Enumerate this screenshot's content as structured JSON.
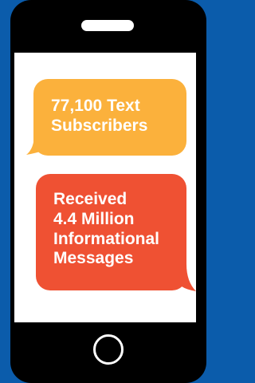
{
  "colors": {
    "background": "#0b5cab",
    "phone_body": "#000000",
    "screen": "#ffffff",
    "bubble_1": "#fbb13c",
    "bubble_2": "#ef5133",
    "text": "#ffffff"
  },
  "messages": [
    {
      "lines": [
        "77,100 Text",
        "Subscribers"
      ],
      "tail": "bottom-left"
    },
    {
      "lines": [
        "Received",
        "4.4 Million",
        "Informational",
        "Messages"
      ],
      "tail": "bottom-right"
    }
  ],
  "icons": {
    "home_button": "home-button-icon",
    "speaker": "speaker-slot-icon"
  }
}
